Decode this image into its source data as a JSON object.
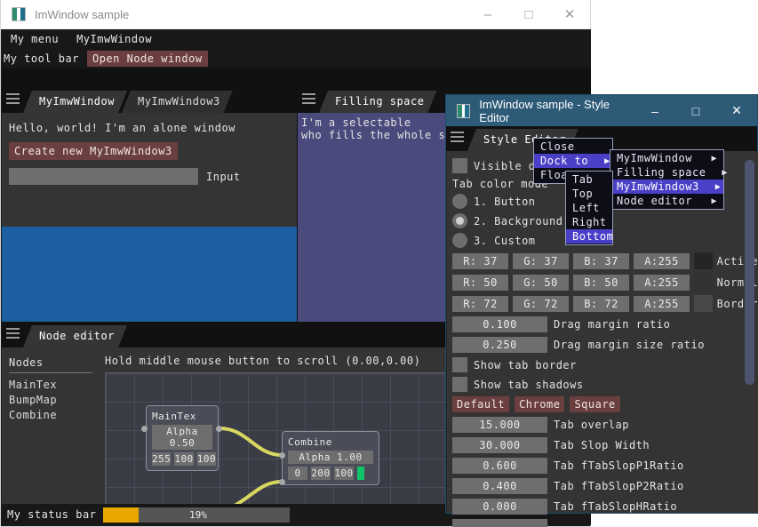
{
  "main_window": {
    "title": "ImWindow sample",
    "controls": {
      "minimize": "–",
      "maximize": "□",
      "close": "✕"
    },
    "menubar": {
      "items": [
        "My menu",
        "MyImwWindow"
      ]
    },
    "toolbar": {
      "label": "My tool bar",
      "button": "Open Node window"
    },
    "statusbar": {
      "label": "My status bar",
      "progress_text": "19%",
      "progress_value": 19
    }
  },
  "left_panel": {
    "tabs": [
      {
        "label": "MyImwWindow",
        "active": true
      },
      {
        "label": "MyImwWindow3",
        "active": false
      }
    ],
    "hello_text": "Hello, world! I'm an alone window",
    "create_button": "Create new MyImwWindow3",
    "input_value": "",
    "input_placeholder": "",
    "input_label": "Input",
    "drop_highlight_color": "#1b5fa0"
  },
  "right_panel": {
    "tabs": [
      {
        "label": "Filling space",
        "active": true
      }
    ],
    "selectable_line1": "I'm a selectable",
    "selectable_line2": "who fills the whole space",
    "background_color": "#4a4a7c"
  },
  "node_editor": {
    "tabs": [
      {
        "label": "Node editor",
        "active": true
      }
    ],
    "nodes_header": "Nodes",
    "nodes": [
      "MainTex",
      "BumpMap",
      "Combine"
    ],
    "hint": "Hold middle mouse button to scroll (0.00,0.00)",
    "graph_nodes": [
      {
        "title": "MainTex",
        "slider_label": "Alpha",
        "slider_value": "0.50",
        "cells": [
          "255",
          "100",
          "100"
        ],
        "swatch": "#ff5c5c"
      },
      {
        "title": "Combine",
        "slider_label": "Alpha",
        "slider_value": "1.00",
        "cells": [
          "0",
          "200",
          "100"
        ],
        "swatch": "#12c469"
      }
    ],
    "link_color": "#d8d860"
  },
  "style_editor": {
    "title": "ImWindow sample - Style Editor",
    "controls": {
      "minimize": "–",
      "maximize": "□",
      "close": "✕"
    },
    "tab_label": "Style Editor",
    "visible_drag_checkbox": {
      "label": "Visible dragging",
      "checked": false
    },
    "tab_color_mode_label": "Tab color mode",
    "color_modes": [
      {
        "label": "1. Button",
        "selected": false
      },
      {
        "label": "2. Background",
        "selected": true
      },
      {
        "label": "3. Custom",
        "selected": false
      }
    ],
    "color_rows": [
      {
        "r": "R: 37",
        "g": "G: 37",
        "b": "B: 37",
        "a": "A:255",
        "swatch": "#252525",
        "name": "Active"
      },
      {
        "r": "R: 50",
        "g": "G: 50",
        "b": "B: 50",
        "a": "A:255",
        "swatch": "#323232",
        "name": "Normal"
      },
      {
        "r": "R: 72",
        "g": "G: 72",
        "b": "B: 72",
        "a": "A:255",
        "swatch": "#484848",
        "name": "Border"
      }
    ],
    "drags": [
      {
        "value": "0.100",
        "label": "Drag margin ratio"
      },
      {
        "value": "0.250",
        "label": "Drag margin size ratio"
      }
    ],
    "checkboxes": [
      {
        "label": "Show tab border",
        "checked": false
      },
      {
        "label": "Show tab shadows",
        "checked": false
      }
    ],
    "preset_buttons": [
      "Default",
      "Chrome",
      "Square"
    ],
    "tab_drags": [
      {
        "value": "15.000",
        "label": "Tab overlap"
      },
      {
        "value": "30.000",
        "label": "Tab Slop Width"
      },
      {
        "value": "0.600",
        "label": "Tab fTabSlopP1Ratio"
      },
      {
        "value": "0.400",
        "label": "Tab fTabSlopP2Ratio"
      },
      {
        "value": "0.000",
        "label": "Tab fTabSlopHRatio"
      }
    ],
    "titlebar_color": "#2d5b77"
  },
  "context_menus": {
    "dock_menu": [
      {
        "label": "Close",
        "selected": false,
        "arrow": ""
      },
      {
        "label": "Dock to",
        "selected": true,
        "arrow": "▶"
      },
      {
        "label": "Float",
        "selected": false,
        "arrow": ""
      }
    ],
    "side_menu": [
      {
        "label": "Tab",
        "selected": false
      },
      {
        "label": "Top",
        "selected": false
      },
      {
        "label": "Left",
        "selected": false
      },
      {
        "label": "Right",
        "selected": false
      },
      {
        "label": "Bottom",
        "selected": true
      }
    ],
    "target_menu": [
      {
        "label": "MyImwWindow",
        "selected": false,
        "arrow": "▶"
      },
      {
        "label": "Filling space",
        "selected": false,
        "arrow": "▶"
      },
      {
        "label": "MyImwWindow3",
        "selected": true,
        "arrow": "▶"
      },
      {
        "label": "Node editor",
        "selected": false,
        "arrow": "▶"
      }
    ]
  }
}
